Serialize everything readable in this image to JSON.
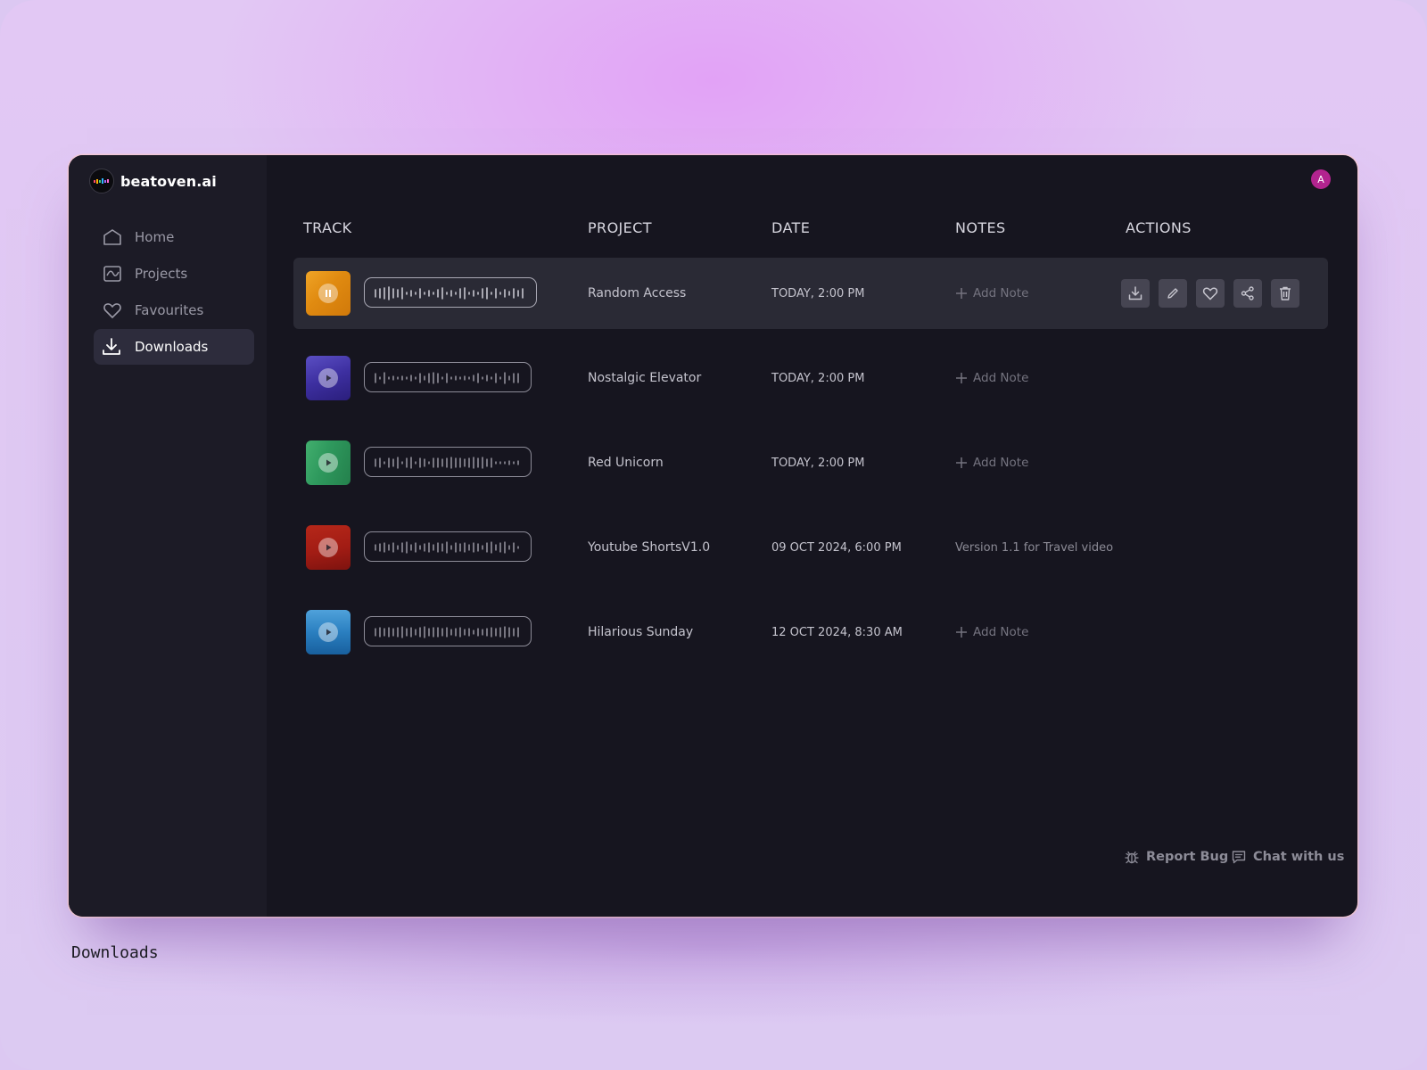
{
  "app": {
    "brand": "beatoven.ai",
    "avatar_initial": "A",
    "avatar_color": "#b2248f"
  },
  "sidebar": {
    "items": [
      {
        "label": "Home",
        "icon": "home-icon",
        "active": false
      },
      {
        "label": "Projects",
        "icon": "projects-icon",
        "active": false
      },
      {
        "label": "Favourites",
        "icon": "heart-icon",
        "active": false
      },
      {
        "label": "Downloads",
        "icon": "download-icon",
        "active": true
      }
    ]
  },
  "table": {
    "headers": {
      "track": "TRACK",
      "project": "PROJECT",
      "date": "DATE",
      "notes": "NOTES",
      "actions": "ACTIONS"
    },
    "rows": [
      {
        "project": "Random Access",
        "date": "TODAY, 2:00 PM",
        "note": "Add Note",
        "has_note": false,
        "playing": true,
        "thumb_color": "#e08a10"
      },
      {
        "project": "Nostalgic Elevator",
        "date": "TODAY, 2:00 PM",
        "note": "Add Note",
        "has_note": false,
        "playing": false,
        "thumb_color": "#3d2fa0"
      },
      {
        "project": "Red Unicorn",
        "date": "TODAY, 2:00 PM",
        "note": "Add Note",
        "has_note": false,
        "playing": false,
        "thumb_color": "#2f9a5e"
      },
      {
        "project": "Youtube ShortsV1.0",
        "date": "09 OCT 2024, 6:00 PM",
        "note": "Version 1.1 for Travel video",
        "has_note": true,
        "playing": false,
        "thumb_color": "#a21c14"
      },
      {
        "project": "Hilarious Sunday",
        "date": "12 OCT 2024, 8:30 AM",
        "note": "Add Note",
        "has_note": false,
        "playing": false,
        "thumb_color": "#2a7fc0"
      }
    ],
    "row_actions": [
      "download-icon",
      "edit-icon",
      "heart-icon",
      "share-icon",
      "trash-icon"
    ]
  },
  "footer": {
    "report_bug": "Report Bug",
    "chat": "Chat with us"
  },
  "caption": "Downloads"
}
